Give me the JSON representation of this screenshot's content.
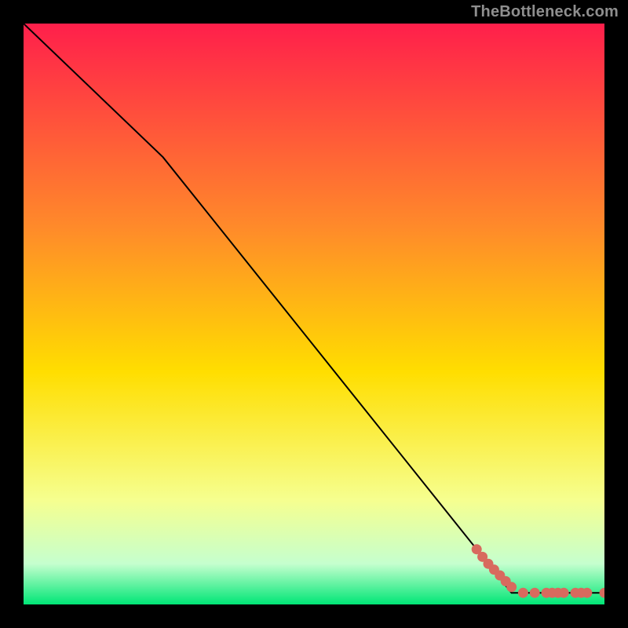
{
  "watermark": "TheBottleneck.com",
  "colors": {
    "bg": "#000000",
    "watermark": "#8e8e8e",
    "line": "#000000",
    "marker": "#d86a5e"
  },
  "chart_data": {
    "type": "line",
    "title": "",
    "xlabel": "",
    "ylabel": "",
    "xlim": [
      0,
      100
    ],
    "ylim": [
      0,
      100
    ],
    "grid": false,
    "background_gradient": {
      "top": "#ff1f4b",
      "mid_top": "#ff8a2a",
      "mid": "#ffde00",
      "mid_low": "#f6ff8f",
      "low": "#c5ffce",
      "bottom": "#00e676"
    },
    "series": [
      {
        "name": "bottleneck curve",
        "x": [
          0,
          24,
          84,
          100
        ],
        "y": [
          100,
          77,
          2,
          2
        ],
        "style": "line"
      },
      {
        "name": "markers",
        "x": [
          78,
          79,
          80,
          81,
          82,
          83,
          84,
          86,
          88,
          90,
          91,
          92,
          93,
          95,
          96,
          97,
          100
        ],
        "y": [
          9.5,
          8.2,
          7,
          6,
          5,
          4,
          3,
          2,
          2,
          2,
          2,
          2,
          2,
          2,
          2,
          2,
          2
        ],
        "style": "scatter"
      }
    ]
  }
}
